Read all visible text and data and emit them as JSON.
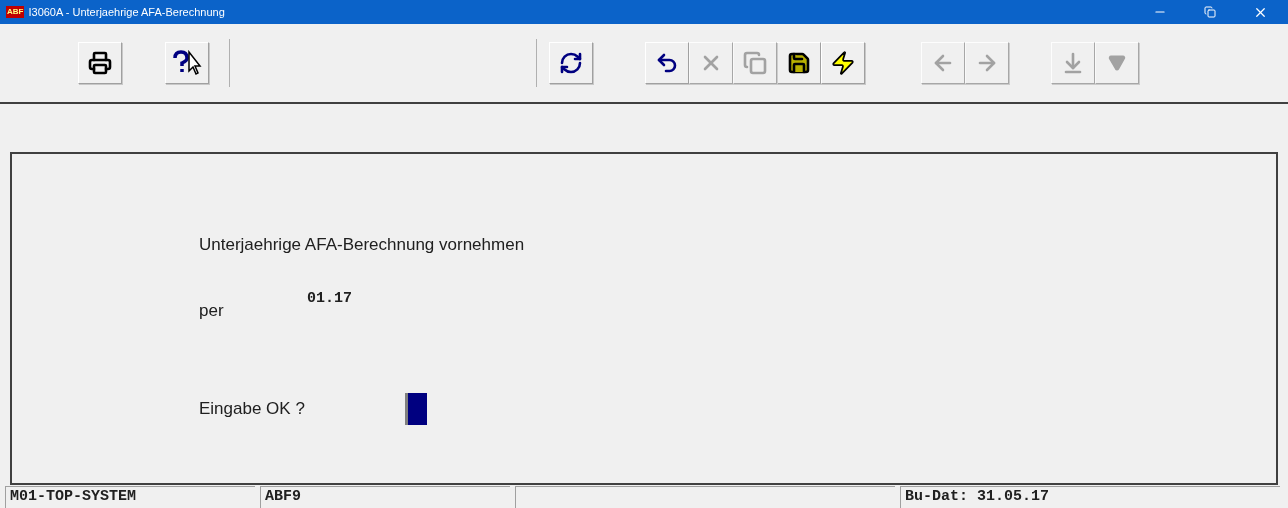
{
  "window": {
    "title": "I3060A  - Unterjaehrige AFA-Berechnung",
    "app_badge": "ABF"
  },
  "toolbar": {
    "groups": [
      [
        {
          "kind": "print",
          "disabled": false
        },
        {
          "kind": "help",
          "disabled": false
        }
      ],
      [
        {
          "kind": "refresh",
          "disabled": false
        }
      ],
      [
        {
          "kind": "undo",
          "disabled": false
        },
        {
          "kind": "delete",
          "disabled": true
        },
        {
          "kind": "copy",
          "disabled": true
        },
        {
          "kind": "save",
          "disabled": false
        },
        {
          "kind": "execute",
          "disabled": false
        }
      ],
      [
        {
          "kind": "back",
          "disabled": true
        },
        {
          "kind": "forward",
          "disabled": true
        }
      ],
      [
        {
          "kind": "download",
          "disabled": true
        },
        {
          "kind": "dropdown",
          "disabled": true
        }
      ]
    ]
  },
  "form": {
    "heading": "Unterjaehrige AFA-Berechnung vornehmen",
    "period_label": "per",
    "period_value": "01.17",
    "confirm_label": "Eingabe OK ?"
  },
  "status_bar": {
    "left": [
      "M01-TOP-SYSTEM",
      "ABF9"
    ],
    "right": [
      "Bu-Dat: 31.05.17"
    ]
  }
}
